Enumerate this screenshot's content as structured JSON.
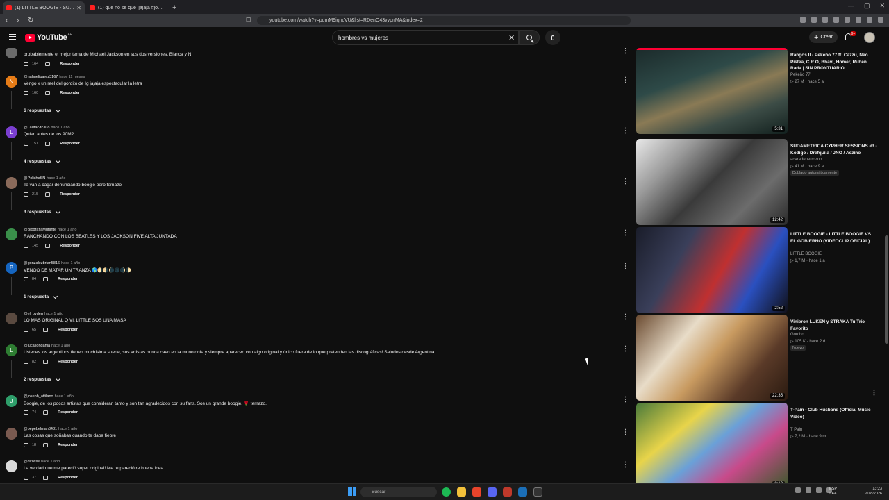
{
  "browser": {
    "tabs": [
      {
        "title": "(1) LITTLE BOOGIE - SUAVE CRIMINAL",
        "active": true
      },
      {
        "title": "(1) que no se que jjajaja #joacolopez",
        "active": false
      }
    ],
    "url": "youtube.com/watch?v=pqmM9iqncVU&list=RDenO43vypnMA&index=2"
  },
  "youtube": {
    "logo_text": "YouTube",
    "region": "AR",
    "search_value": "hombres vs mujeres",
    "create_label": "Crear",
    "notification_count": "9+"
  },
  "comments": [
    {
      "handle": "",
      "time": "",
      "text": "probablemente el mejor tema de Michael Jackson en sus dos versiones, Blanca y N",
      "likes": "164",
      "reply_label": "Responder",
      "avatar_letter": "",
      "avatar_color": "#6b6b6b",
      "replies": ""
    },
    {
      "handle": "@nahueljuarez3167",
      "time": "hace 11 meses",
      "text": "Vengo x un reel del gordito de Ig jajaja espectacular la letra",
      "likes": "160",
      "reply_label": "Responder",
      "avatar_letter": "N",
      "avatar_color": "#e67c17",
      "replies": "6 respuestas"
    },
    {
      "handle": "@Lautac-tc3uo",
      "time": "hace 1 año",
      "text": "Quien antes de los 90M?",
      "likes": "151",
      "reply_label": "Responder",
      "avatar_letter": "L",
      "avatar_color": "#7b3fd0",
      "replies": "4 respuestas"
    },
    {
      "handle": "@PolishaSN",
      "time": "hace 1 año",
      "text": "Te van a cagar denunciando boogie pero temazo",
      "likes": "215",
      "reply_label": "Responder",
      "avatar_letter": "",
      "avatar_color": "#8a6a5a",
      "replies": "3 respuestas"
    },
    {
      "handle": "@BiografiaMutante",
      "time": "hace 1 año",
      "text": "RANCHANDO CON LOS BEATLES Y LOS JACKSON FIVE ALTA JUNTADA",
      "likes": "145",
      "reply_label": "Responder",
      "avatar_letter": "",
      "avatar_color": "#3a8f4a",
      "replies": ""
    },
    {
      "handle": "@gonzalezbrian5816",
      "time": "hace 1 año",
      "text": "VENGO DE MATAR UN TRANZA 🌎🌖🌗🌘🌑🌒🌓",
      "likes": "84",
      "reply_label": "Responder",
      "avatar_letter": "B",
      "avatar_color": "#1565c0",
      "replies": "1 respuesta"
    },
    {
      "handle": "@el_byden",
      "time": "hace 1 año",
      "text": "LO MAS ORIGINAL Q VI, LITTLE SOS UNA MASA",
      "likes": "65",
      "reply_label": "Responder",
      "avatar_letter": "",
      "avatar_color": "#5a4a40",
      "replies": ""
    },
    {
      "handle": "@lucasongania",
      "time": "hace 1 año",
      "text": "Ustedes los argentinos tienen muchísima suerte, sus artistas nunca caen en la monotonía y siempre aparecen con algo original y único fuera de lo que pretenden las discográficas! Saludos desde Argentina",
      "likes": "82",
      "reply_label": "Responder",
      "avatar_letter": "L",
      "avatar_color": "#2e7d32",
      "replies": "2 respuestas"
    },
    {
      "handle": "@joseph_attilano",
      "time": "hace 1 año",
      "text": "Boogie, de los pocos artistas que consideran tanto y son tan agradecidos con su fans. Sos un grande boogie. 🌹 temazo.",
      "likes": "74",
      "reply_label": "Responder",
      "avatar_letter": "J",
      "avatar_color": "#2e9e6a",
      "replies": ""
    },
    {
      "handle": "@pepebelman8481",
      "time": "hace 1 año",
      "text": "Las cosas que soñabas cuando te daba fiebre",
      "likes": "18",
      "reply_label": "Responder",
      "avatar_letter": "",
      "avatar_color": "#7a5a50",
      "replies": ""
    },
    {
      "handle": "@dirosss",
      "time": "hace 1 año",
      "text": "La verdad que me pareció super original! Me re pareció re buena idea",
      "likes": "37",
      "reply_label": "Responder",
      "avatar_letter": "",
      "avatar_color": "#d9d9d9",
      "replies": ""
    }
  ],
  "related": [
    {
      "title": "Rangos II - Pekeño 77 ft. Cazzu, Neo Pistea, C.R.O, Bhavi, Homer, Ruben Rada | SIN PRONTUARIO",
      "channel": "Pekeño 77",
      "views": "27 M",
      "age": "hace 5 a",
      "duration": "5:31",
      "badge": "",
      "bg": "linear-gradient(160deg,#1b2a2a 0%,#2e4a48 35%,#8a7a55 55%,#3c4c46 75%,#12201e 100%)"
    },
    {
      "title": "SUDAMETRICA CYPHER SESSIONS #3 - Kodigo / Drefquila / JNO / Aczino",
      "channel": "acaradeperrozoo",
      "views": "41 M",
      "age": "hace 9 a",
      "duration": "12:42",
      "badge": "Doblado automáticamente",
      "bg": "linear-gradient(135deg,#e8e8e8 0%,#9a9a9a 25%,#3a3a3a 50%,#6c6c6c 75%,#2a2a2a 100%)"
    },
    {
      "title": "LITTLE BOOGIE - LITTLE BOOGIE VS EL GOBIERNO (VIDEOCLIP OFICIAL)",
      "channel": "LITTLE BOOGIE",
      "views": "1,7 M",
      "age": "hace 1 a",
      "duration": "2:52",
      "badge": "",
      "bg": "linear-gradient(120deg,#1a1d2a 0%,#3a3f5a 30%,#c03030 55%,#2a50c0 75%,#101018 100%)"
    },
    {
      "title": "Vinieron LUKEN y STRAKA Tu Trío Favorito",
      "channel": "Gorcho",
      "views": "105 K",
      "age": "hace 2 d",
      "duration": "22:35",
      "badge": "Nuevo",
      "bg": "linear-gradient(130deg,#6a4a30 0%,#e8dcc8 30%,#c89a60 50%,#5a3a28 75%,#2a1a10 100%)"
    },
    {
      "title": "T-Pain - Club Husband (Official Music Video)",
      "channel": "T Pain",
      "views": "7,2 M",
      "age": "hace 9 m",
      "duration": "8:10",
      "badge": "",
      "bg": "linear-gradient(140deg,#4a7a3a 0%,#e8d44a 30%,#6aa0d8 50%,#c84a8a 70%,#3a5a2a 100%)"
    }
  ],
  "taskbar": {
    "search_placeholder": "Buscar",
    "lang_1": "ESP",
    "lang_2": "LAA",
    "time": "13:23",
    "date": "20/8/2026"
  }
}
